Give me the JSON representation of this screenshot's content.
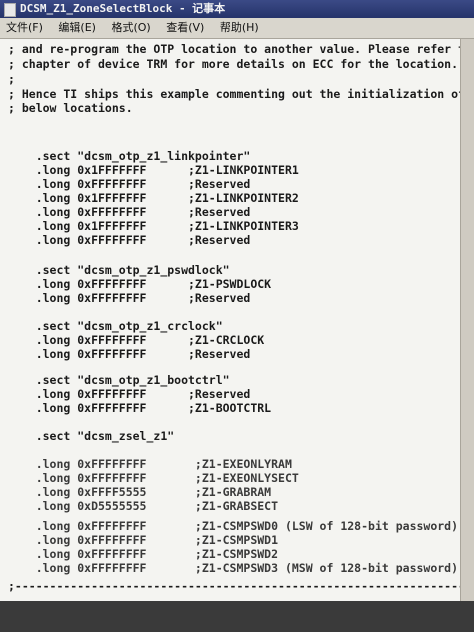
{
  "window": {
    "title": "DCSM_Z1_ZoneSelectBlock - 记事本"
  },
  "menubar": {
    "items": [
      {
        "label": "文件(F)"
      },
      {
        "label": "编辑(E)"
      },
      {
        "label": "格式(O)"
      },
      {
        "label": "查看(V)"
      },
      {
        "label": "帮助(H)"
      }
    ]
  },
  "editor": {
    "lines": [
      "; and re-program the OTP location to another value. Please refer to the",
      "; chapter of device TRM for more details on ECC for the location.",
      ";",
      "; Hence TI ships this example commenting out the initialization of the",
      "; below locations.",
      "",
      "",
      "    .sect \"dcsm_otp_z1_linkpointer\"",
      "    .long 0x1FFFFFFF      ;Z1-LINKPOINTER1",
      "    .long 0xFFFFFFFF      ;Reserved",
      "    .long 0x1FFFFFFF      ;Z1-LINKPOINTER2",
      "    .long 0xFFFFFFFF      ;Reserved",
      "    .long 0x1FFFFFFF      ;Z1-LINKPOINTER3",
      "    .long 0xFFFFFFFF      ;Reserved",
      "",
      "    .sect \"dcsm_otp_z1_pswdlock\"",
      "    .long 0xFFFFFFFF      ;Z1-PSWDLOCK",
      "    .long 0xFFFFFFFF      ;Reserved",
      "",
      "    .sect \"dcsm_otp_z1_crclock\"",
      "    .long 0xFFFFFFFF      ;Z1-CRCLOCK",
      "    .long 0xFFFFFFFF      ;Reserved",
      "",
      "    .sect \"dcsm_otp_z1_bootctrl\"",
      "    .long 0xFFFFFFFF      ;Reserved",
      "    .long 0xFFFFFFFF      ;Z1-BOOTCTRL",
      "",
      "    .sect \"dcsm_zsel_z1\"",
      "",
      "    .long 0xFFFFFFFF       ;Z1-EXEONLYRAM",
      "    .long 0xFFFFFFFF       ;Z1-EXEONLYSECT",
      "    .long 0xFFFF5555       ;Z1-GRABRAM",
      "    .long 0xD5555555       ;Z1-GRABSECT",
      "",
      "    .long 0xFFFFFFFF       ;Z1-CSMPSWD0 (LSW of 128-bit password)",
      "    .long 0xFFFFFFFF       ;Z1-CSMPSWD1",
      "    .long 0xFFFFFFFF       ;Z1-CSMPSWD2",
      "    .long 0xFFFFFFFF       ;Z1-CSMPSWD3 (MSW of 128-bit password)",
      "",
      ";----------------------------------------------------------------------"
    ]
  }
}
